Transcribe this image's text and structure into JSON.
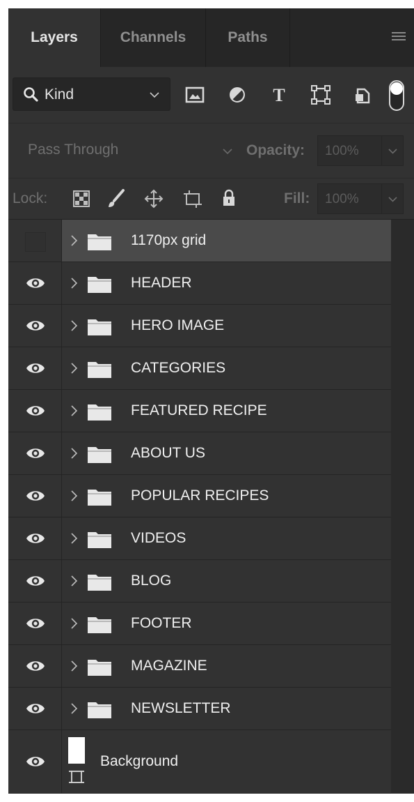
{
  "tabs": [
    {
      "label": "Layers",
      "active": true
    },
    {
      "label": "Channels",
      "active": false
    },
    {
      "label": "Paths",
      "active": false
    }
  ],
  "panel_menu_icon": "hamburger-menu-icon",
  "filter": {
    "kind_label": "Kind",
    "kind_icon": "search-icon",
    "filter_icons": [
      "image-filter-icon",
      "adjustment-filter-icon",
      "type-filter-icon",
      "shape-filter-icon",
      "smart-object-filter-icon",
      "filter-toggle-icon"
    ]
  },
  "blend": {
    "mode": "Pass Through",
    "opacity_label": "Opacity:",
    "opacity_value": "100%"
  },
  "lock": {
    "label": "Lock:",
    "icons": [
      "lock-transparent-icon",
      "lock-pixels-icon",
      "lock-position-icon",
      "lock-artboard-icon",
      "lock-all-icon"
    ],
    "fill_label": "Fill:",
    "fill_value": "100%"
  },
  "layers": [
    {
      "name": "1170px grid",
      "visible": false,
      "selected": true
    },
    {
      "name": "HEADER",
      "visible": true
    },
    {
      "name": "HERO IMAGE",
      "visible": true
    },
    {
      "name": "CATEGORIES",
      "visible": true
    },
    {
      "name": "FEATURED RECIPE",
      "visible": true
    },
    {
      "name": "ABOUT US",
      "visible": true
    },
    {
      "name": "POPULAR RECIPES",
      "visible": true
    },
    {
      "name": "VIDEOS",
      "visible": true
    },
    {
      "name": "BLOG",
      "visible": true
    },
    {
      "name": "FOOTER",
      "visible": true
    },
    {
      "name": "MAGAZINE",
      "visible": true
    },
    {
      "name": "NEWSLETTER",
      "visible": true
    }
  ],
  "background_layer": {
    "name": "Background",
    "visible": true
  },
  "colors": {
    "panel_bg": "#323232",
    "tabbar_bg": "#262626",
    "selected_row": "#4a4a4a",
    "text": "#f0f0f0",
    "dim_text": "#6f6f6f"
  }
}
